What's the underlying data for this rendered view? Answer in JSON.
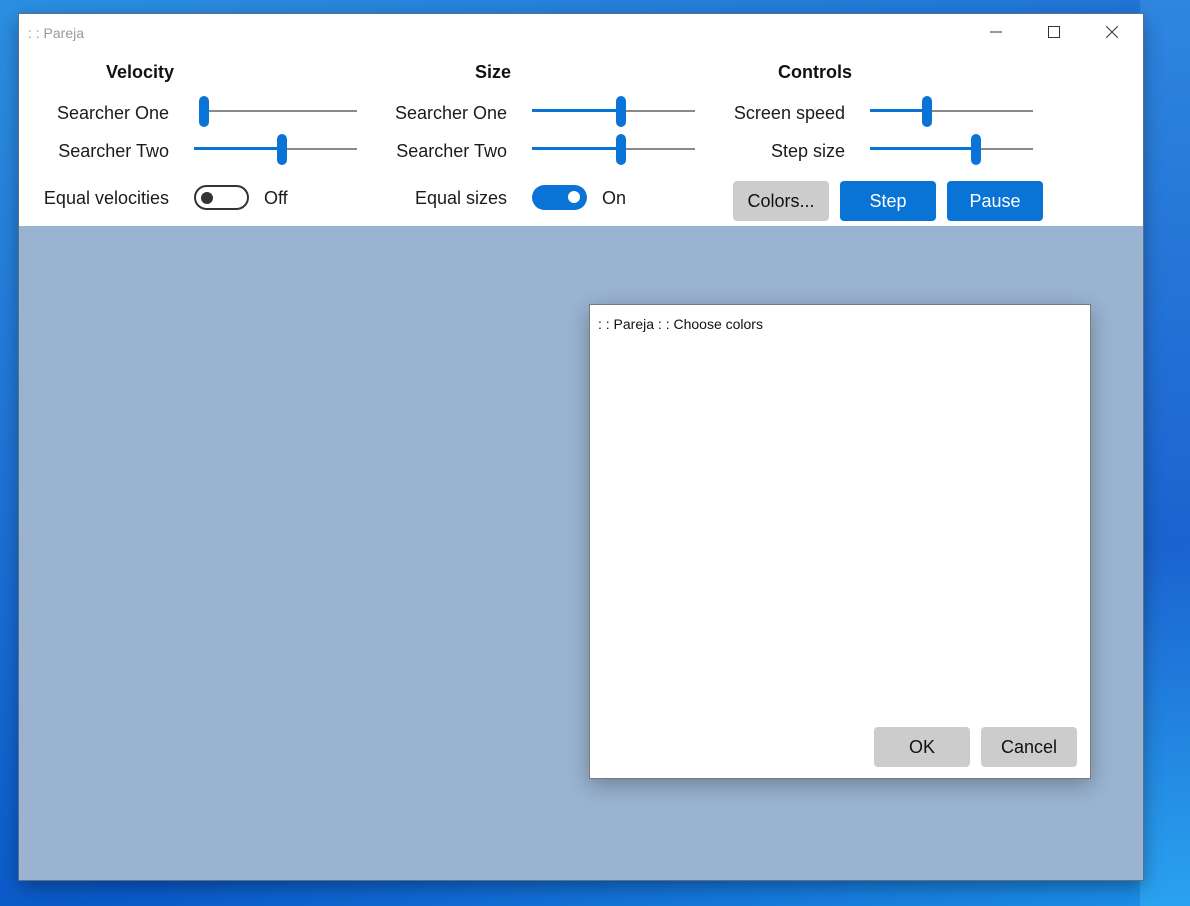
{
  "window": {
    "title": ": : Pareja"
  },
  "velocity": {
    "heading": "Velocity",
    "searcher_one": {
      "label": "Searcher One",
      "value": 0.0
    },
    "searcher_two": {
      "label": "Searcher Two",
      "value": 0.54
    },
    "equal": {
      "label": "Equal velocities",
      "state": "Off"
    }
  },
  "size": {
    "heading": "Size",
    "searcher_one": {
      "label": "Searcher One",
      "value": 0.55
    },
    "searcher_two": {
      "label": "Searcher Two",
      "value": 0.55
    },
    "equal": {
      "label": "Equal sizes",
      "state": "On"
    }
  },
  "controls": {
    "heading": "Controls",
    "screen_speed": {
      "label": "Screen speed",
      "value": 0.34
    },
    "step_size": {
      "label": "Step size",
      "value": 0.66
    },
    "colors_button": "Colors...",
    "step_button": "Step",
    "pause_button": "Pause"
  },
  "dialog": {
    "title": ": : Pareja : : Choose colors",
    "ok_button": "OK",
    "cancel_button": "Cancel"
  },
  "colors": {
    "accent": "#0a74d6",
    "canvas": "#99b3d1",
    "button_gray": "#cccccc"
  }
}
